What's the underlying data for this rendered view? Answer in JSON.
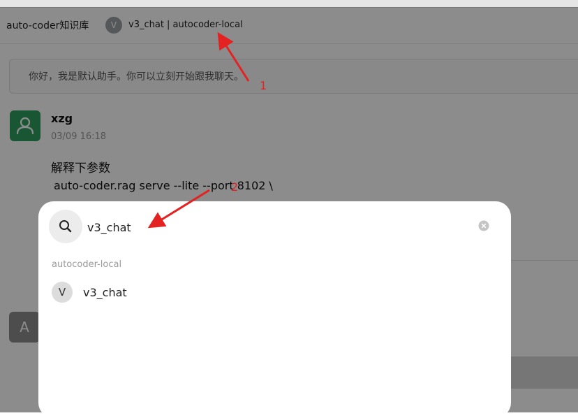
{
  "header": {
    "kb_title": "auto-coder知识库",
    "model_avatar_letter": "V",
    "model_name": "v3_chat | autocoder-local"
  },
  "chat": {
    "welcome_text": "你好，我是默认助手。你可以立刻开始跟我聊天。",
    "user_name": "xzg",
    "timestamp": "03/09 16:18",
    "message_line1": "解释下参数",
    "message_line2": "auto-coder.rag serve --lite --port 8102 \\",
    "assistant_badge": "A"
  },
  "search_dialog": {
    "query": "v3_chat",
    "group_label": "autocoder-local",
    "results": [
      {
        "avatar_letter": "V",
        "name": "v3_chat"
      }
    ]
  },
  "annotations": {
    "marker_1": "1",
    "marker_2": "2",
    "color": "#e32222"
  },
  "colors": {
    "user_avatar": "#2f9e5f",
    "overlay": "rgba(0,0,0,0.45)"
  }
}
